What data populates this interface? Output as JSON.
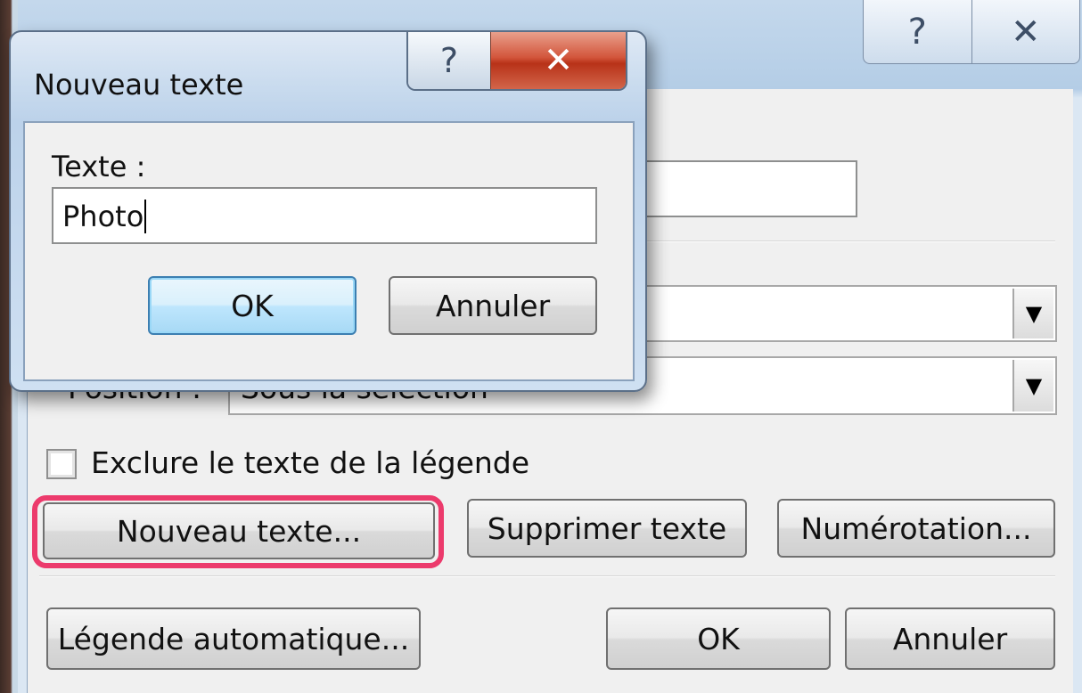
{
  "main_dialog": {
    "help_glyph": "?",
    "close_glyph": "✕",
    "position_label": "Position :",
    "position_value": "Sous la sélection",
    "exclude_label": "Exclure le texte de la légende",
    "buttons": {
      "new_text": "Nouveau texte...",
      "delete_text": "Supprimer texte",
      "numbering": "Numérotation...",
      "auto_caption": "Légende automatique...",
      "ok": "OK",
      "cancel": "Annuler"
    },
    "highlight_color": "#ec3a6c"
  },
  "new_text_dialog": {
    "title": "Nouveau texte",
    "help_glyph": "?",
    "close_glyph": "✕",
    "text_label": "Texte :",
    "text_value": "Photo",
    "ok_label": "OK",
    "cancel_label": "Annuler"
  }
}
